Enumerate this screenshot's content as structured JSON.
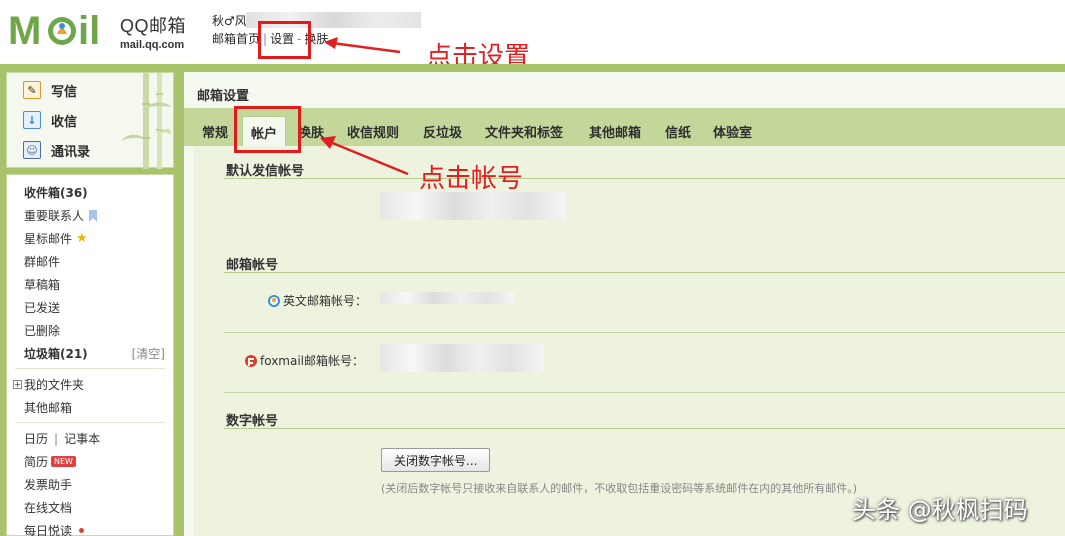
{
  "brand": {
    "name": "QQ邮箱",
    "url": "mail.qq.com"
  },
  "user": {
    "name": "秋♂风"
  },
  "topnav": {
    "home": "邮箱首页",
    "settings": "设置",
    "skin": "换肤"
  },
  "annotations": {
    "click_settings": "点击设置",
    "click_account": "点击帐号"
  },
  "sidebar": {
    "compose": "写信",
    "inbox": "收信",
    "contacts": "通讯录",
    "folders": {
      "inbox": "收件箱(36)",
      "important": "重要联系人",
      "starred": "星标邮件",
      "group": "群邮件",
      "drafts": "草稿箱",
      "sent": "已发送",
      "deleted": "已删除",
      "spam": "垃圾箱(21)",
      "clear": "[清空]",
      "my_folders": "我的文件夹",
      "other_mailbox": "其他邮箱",
      "calendar": "日历",
      "notes": "记事本",
      "resume": "简历",
      "new_badge": "NEW",
      "invoice": "发票助手",
      "docs": "在线文档",
      "daily": "每日悦读"
    }
  },
  "main": {
    "title": "邮箱设置",
    "tabs": [
      "常规",
      "帐户",
      "换肤",
      "收信规则",
      "反垃圾",
      "文件夹和标签",
      "其他邮箱",
      "信纸",
      "体验室"
    ],
    "active_tab": "帐户",
    "sections": {
      "default_sender": "默认发信帐号",
      "mailbox_accounts": "邮箱帐号",
      "english_account_label": "英文邮箱帐号：",
      "foxmail_account_label": "foxmail邮箱帐号：",
      "digital_account": "数字帐号",
      "close_digital_button": "关闭数字帐号...",
      "close_digital_hint": "(关闭后数字帐号只接收来自联系人的邮件，不收取包括重设密码等系统邮件在内的其他所有邮件。)"
    }
  },
  "watermark": "头条 @秋枫扫码",
  "colors": {
    "accent_green": "#a9c36c",
    "annotation_red": "#e02020"
  }
}
